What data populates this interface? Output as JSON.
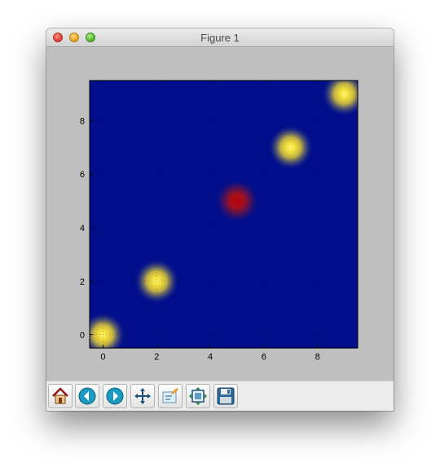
{
  "window": {
    "title": "Figure 1"
  },
  "chart_data": {
    "type": "heatmap",
    "title": "",
    "xlabel": "",
    "ylabel": "",
    "xlim": [
      -0.5,
      9.5
    ],
    "ylim": [
      -0.5,
      9.5
    ],
    "xticks": [
      "0",
      "2",
      "4",
      "6",
      "8"
    ],
    "yticks": [
      "0",
      "2",
      "4",
      "6",
      "8"
    ],
    "grid": true,
    "colormap": "jet",
    "background_value": 0,
    "hotspots": [
      {
        "x": 0,
        "y": 0,
        "value": 0.8
      },
      {
        "x": 2,
        "y": 2,
        "value": 0.8
      },
      {
        "x": 5,
        "y": 5,
        "value": 1.0
      },
      {
        "x": 7,
        "y": 7,
        "value": 0.8
      },
      {
        "x": 9,
        "y": 9,
        "value": 0.8
      }
    ]
  },
  "toolbar": {
    "buttons": [
      {
        "name": "home-button",
        "icon": "home-icon"
      },
      {
        "name": "back-button",
        "icon": "back-arrow-icon"
      },
      {
        "name": "forward-button",
        "icon": "forward-arrow-icon"
      },
      {
        "name": "pan-button",
        "icon": "move-icon"
      },
      {
        "name": "zoom-button",
        "icon": "zoom-rect-icon"
      },
      {
        "name": "subplots-button",
        "icon": "subplots-icon"
      },
      {
        "name": "save-button",
        "icon": "floppy-disk-icon"
      }
    ]
  },
  "colors": {
    "low": "#000e8c",
    "mid": "#f4e13c",
    "high": "#b4000a",
    "figure_bg": "#bfbfbf",
    "toolbar_bg": "#ececec"
  }
}
